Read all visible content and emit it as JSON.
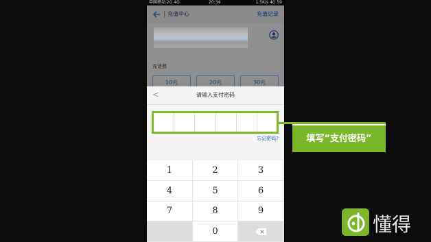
{
  "statusbar": {
    "left": "中国移动 2G 4G",
    "center": "20:34",
    "right": "1.5K/s 4G 59"
  },
  "appbar": {
    "title": "充值中心",
    "record_link": "充值记录"
  },
  "upper": {
    "amount_label": "充话费",
    "amount_options": [
      "10元",
      "20元",
      "30元"
    ]
  },
  "sheet": {
    "back": "<",
    "title": "请输入支付密码",
    "forgot": "忘记密码?"
  },
  "keypad": {
    "keys": [
      "1",
      "2",
      "3",
      "4",
      "5",
      "6",
      "7",
      "8",
      "9",
      "",
      "0",
      "delete"
    ]
  },
  "overlay": {
    "hint": "填写“支付密码”",
    "accent": "#7ab829"
  },
  "brand": {
    "name": "懂得"
  }
}
